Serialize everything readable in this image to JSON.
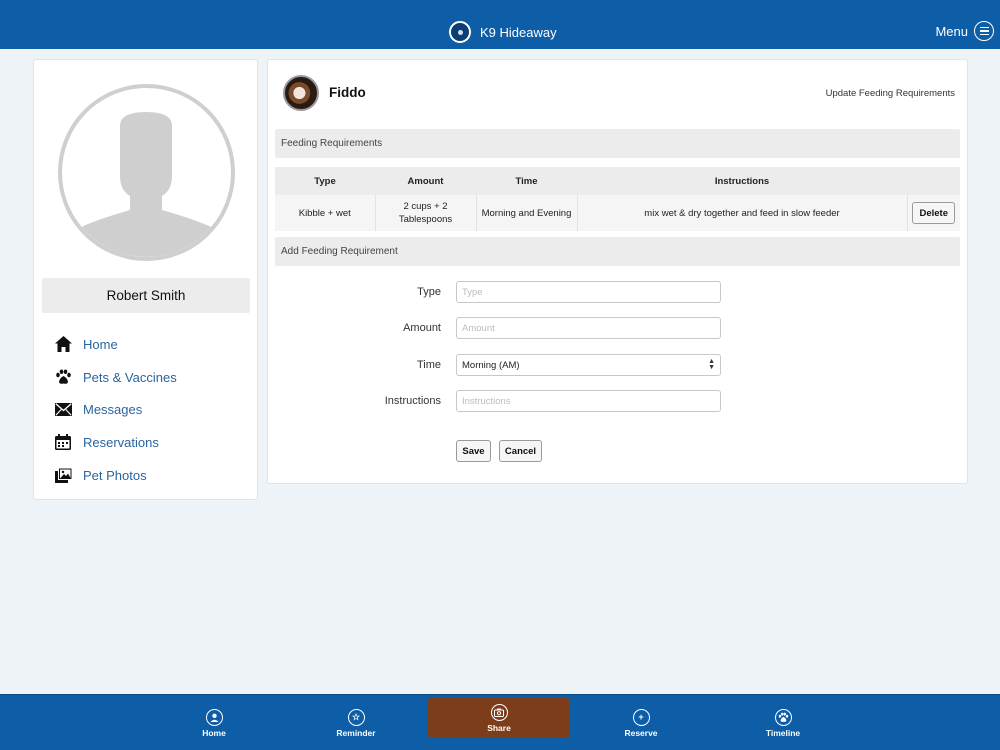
{
  "header": {
    "app_title": "K9 Hideaway",
    "menu_label": "Menu"
  },
  "profile": {
    "name": "Robert Smith"
  },
  "sidebar": {
    "items": [
      {
        "label": "Home",
        "icon": "house-icon"
      },
      {
        "label": "Pets & Vaccines",
        "icon": "paw-icon"
      },
      {
        "label": "Messages",
        "icon": "envelope-icon"
      },
      {
        "label": "Reservations",
        "icon": "calendar-icon"
      },
      {
        "label": "Pet Photos",
        "icon": "photos-icon"
      }
    ]
  },
  "pet": {
    "name": "Fiddo",
    "update_link": "Update Feeding Requirements"
  },
  "feeding": {
    "section_title": "Feeding Requirements",
    "columns": [
      "Type",
      "Amount",
      "Time",
      "Instructions"
    ],
    "rows": [
      {
        "type": "Kibble + wet",
        "amount": "2 cups + 2 Tablespoons",
        "time": "Morning and Evening",
        "instructions": "mix wet & dry together and feed in slow feeder",
        "action": "Delete"
      }
    ]
  },
  "add_form": {
    "section_title": "Add Feeding Requirement",
    "type_label": "Type",
    "type_placeholder": "Type",
    "amount_label": "Amount",
    "amount_placeholder": "Amount",
    "time_label": "Time",
    "time_selected": "Morning (AM)",
    "instructions_label": "Instructions",
    "instructions_placeholder": "Instructions",
    "save_label": "Save",
    "cancel_label": "Cancel"
  },
  "bottom_nav": {
    "home": "Home",
    "reminder": "Reminder",
    "share": "Share",
    "reserve": "Reserve",
    "timeline": "Timeline"
  },
  "colors": {
    "primary": "#0d5da7",
    "share_active": "#7e3d1a",
    "link": "#2a65a0"
  }
}
